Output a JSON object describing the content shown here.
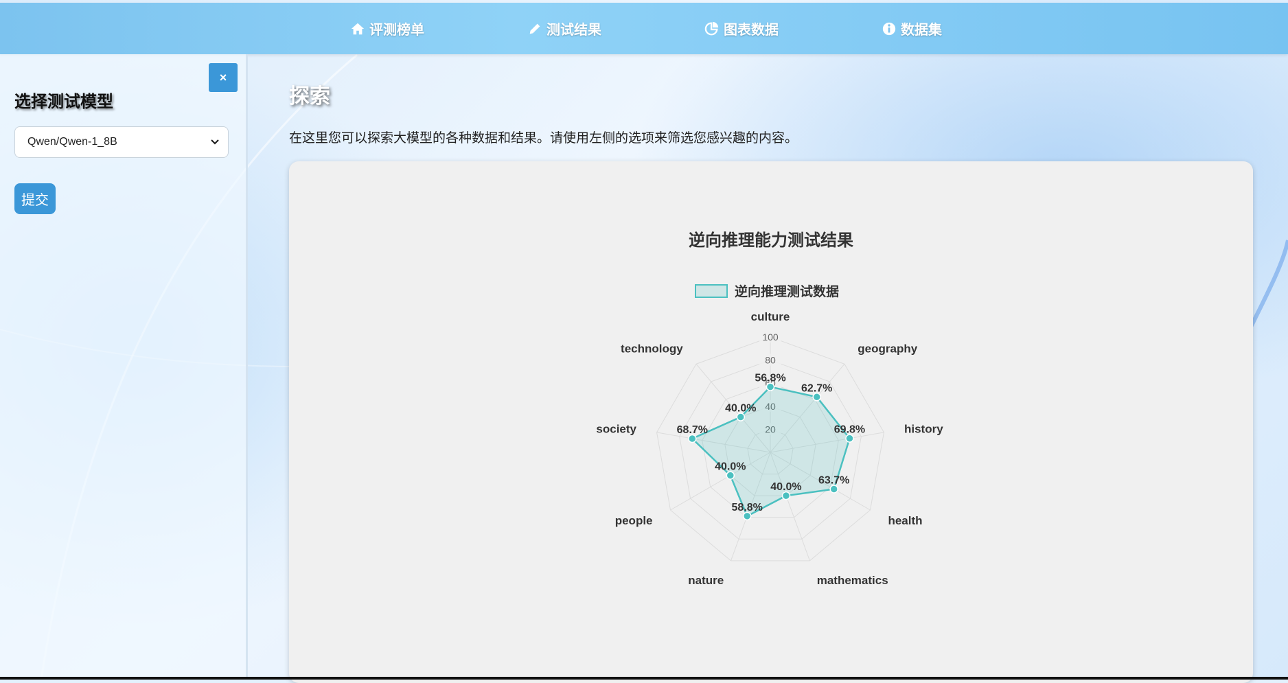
{
  "nav": {
    "items": [
      {
        "label": "评测榜单",
        "icon": "home-icon"
      },
      {
        "label": "测试结果",
        "icon": "pencil-icon"
      },
      {
        "label": "图表数据",
        "icon": "pie-chart-icon"
      },
      {
        "label": "数据集",
        "icon": "info-icon"
      }
    ]
  },
  "sidebar": {
    "close_label": "×",
    "title": "选择测试模型",
    "model_select": {
      "value": "Qwen/Qwen-1_8B"
    },
    "submit_label": "提交"
  },
  "main": {
    "title": "探索",
    "description": "在这里您可以探索大模型的各种数据和结果。请使用左侧的选项来筛选您感兴趣的内容。"
  },
  "colors": {
    "accent": "#3b97d8",
    "series_stroke": "#4bc0c0",
    "series_fill": "rgba(75,192,192,0.2)"
  },
  "chart_data": {
    "type": "radar",
    "title": "逆向推理能力测试结果",
    "categories": [
      "culture",
      "geography",
      "history",
      "health",
      "mathematics",
      "nature",
      "people",
      "society",
      "technology"
    ],
    "series": [
      {
        "name": "逆向推理测试数据",
        "values": [
          56.8,
          62.7,
          69.8,
          63.7,
          40.0,
          58.8,
          40.0,
          68.7,
          40.0
        ]
      }
    ],
    "data_labels": [
      "56.8%",
      "62.7%",
      "69.8%",
      "63.7%",
      "40.0%",
      "58.8%",
      "40.0%",
      "68.7%",
      "40.0%"
    ],
    "r_ticks": [
      "20",
      "40",
      "60",
      "80",
      "100"
    ],
    "rlim": [
      0,
      100
    ],
    "legend_position": "top",
    "grid": true
  }
}
